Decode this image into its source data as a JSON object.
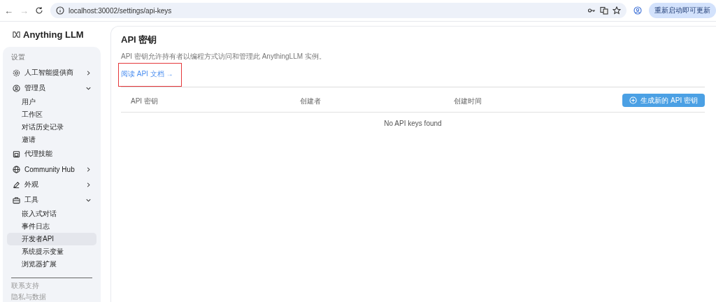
{
  "browser": {
    "back": "←",
    "forward": "→",
    "url": "localhost:30002/settings/api-keys",
    "update_button": "重新启动即可更新"
  },
  "sidebar": {
    "logo": "Anything LLM",
    "section_title": "设置",
    "items": [
      {
        "label": "人工智能提供商",
        "expanded": false
      },
      {
        "label": "管理员",
        "expanded": true,
        "children": [
          {
            "label": "用户",
            "selected": false
          },
          {
            "label": "工作区",
            "selected": false
          },
          {
            "label": "对话历史记录",
            "selected": false
          },
          {
            "label": "邀请",
            "selected": false
          }
        ]
      },
      {
        "label": "代理技能"
      },
      {
        "label": "Community Hub",
        "expanded": false
      },
      {
        "label": "外观",
        "expanded": false
      },
      {
        "label": "工具",
        "expanded": true,
        "children": [
          {
            "label": "嵌入式对话",
            "selected": false
          },
          {
            "label": "事件日志",
            "selected": false
          },
          {
            "label": "开发者API",
            "selected": true
          },
          {
            "label": "系统提示变量",
            "selected": false
          },
          {
            "label": "浏览器扩展",
            "selected": false
          }
        ]
      }
    ],
    "footer_links": [
      "联系支持",
      "隐私与数据"
    ]
  },
  "main": {
    "title": "API 密钥",
    "description": "API 密钥允许持有者以编程方式访问和管理此 AnythingLLM 实例。",
    "docs_link": {
      "label": "阅读 API 文档 →",
      "highlighted": true
    },
    "generate_button": "生成新的 API 密钥",
    "table": {
      "columns": [
        "API 密钥",
        "创建者",
        "创建时间"
      ],
      "empty_message": "No API keys found"
    }
  }
}
